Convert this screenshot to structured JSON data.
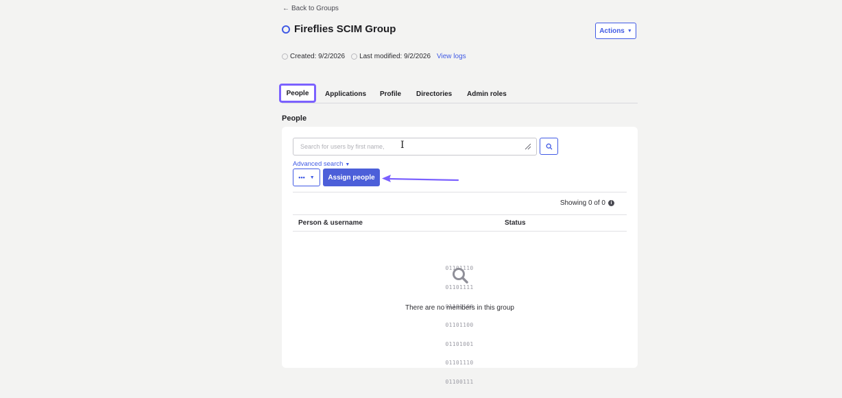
{
  "nav": {
    "back_label": "Back to Groups"
  },
  "header": {
    "title": "Fireflies SCIM Group",
    "actions_label": "Actions"
  },
  "meta": {
    "created": "Created: 9/2/2026",
    "modified": "Last modified: 9/2/2026",
    "view_logs": "View logs"
  },
  "tabs": [
    {
      "label": "People",
      "active": true
    },
    {
      "label": "Applications",
      "active": false
    },
    {
      "label": "Profile",
      "active": false
    },
    {
      "label": "Directories",
      "active": false
    },
    {
      "label": "Admin roles",
      "active": false
    }
  ],
  "section_title": "People",
  "search": {
    "placeholder": "Search for users by first name,",
    "advanced_label": "Advanced search"
  },
  "toolbar": {
    "more_label": "•••",
    "assign_label": "Assign people"
  },
  "table": {
    "showing": "Showing 0 of 0",
    "columns": [
      "Person & username",
      "Status"
    ]
  },
  "empty_state": {
    "binary_lines": [
      "01101110",
      "01101111",
      "01101100",
      "01101100",
      "01101001",
      "01101110",
      "01100111"
    ],
    "message": "There are no members in this group"
  },
  "colors": {
    "accent": "#3f59e4",
    "primary_button": "#4c5fd9",
    "highlight": "#7b61ff",
    "background": "#f3f3f2"
  }
}
